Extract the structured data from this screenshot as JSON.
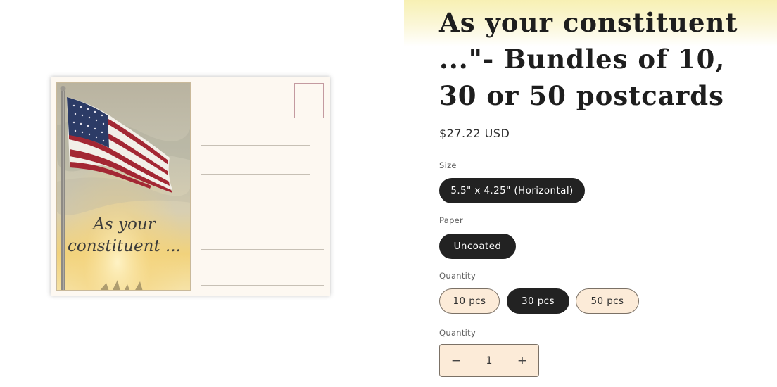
{
  "product": {
    "title": "As your constituent ...\"- Bundles of 10, 30 or 50 postcards",
    "price": "$27.22 USD",
    "image": {
      "card_text_line1": "As your",
      "card_text_line2": "constituent ..."
    }
  },
  "options": {
    "size": {
      "label": "Size",
      "values": [
        "5.5\" x 4.25\" (Horizontal)"
      ],
      "selected": "5.5\" x 4.25\" (Horizontal)"
    },
    "paper": {
      "label": "Paper",
      "values": [
        "Uncoated"
      ],
      "selected": "Uncoated"
    },
    "bundle": {
      "label": "Quantity",
      "values": [
        "10 pcs",
        "30 pcs",
        "50 pcs"
      ],
      "selected": "30 pcs"
    }
  },
  "quantity": {
    "label": "Quantity",
    "value": "1",
    "minus_icon": "minus-icon",
    "plus_icon": "plus-icon"
  },
  "colors": {
    "selected_pill": "#222222",
    "unselected_pill": "#fcebd8",
    "title_highlight": "#f7f0b3"
  }
}
